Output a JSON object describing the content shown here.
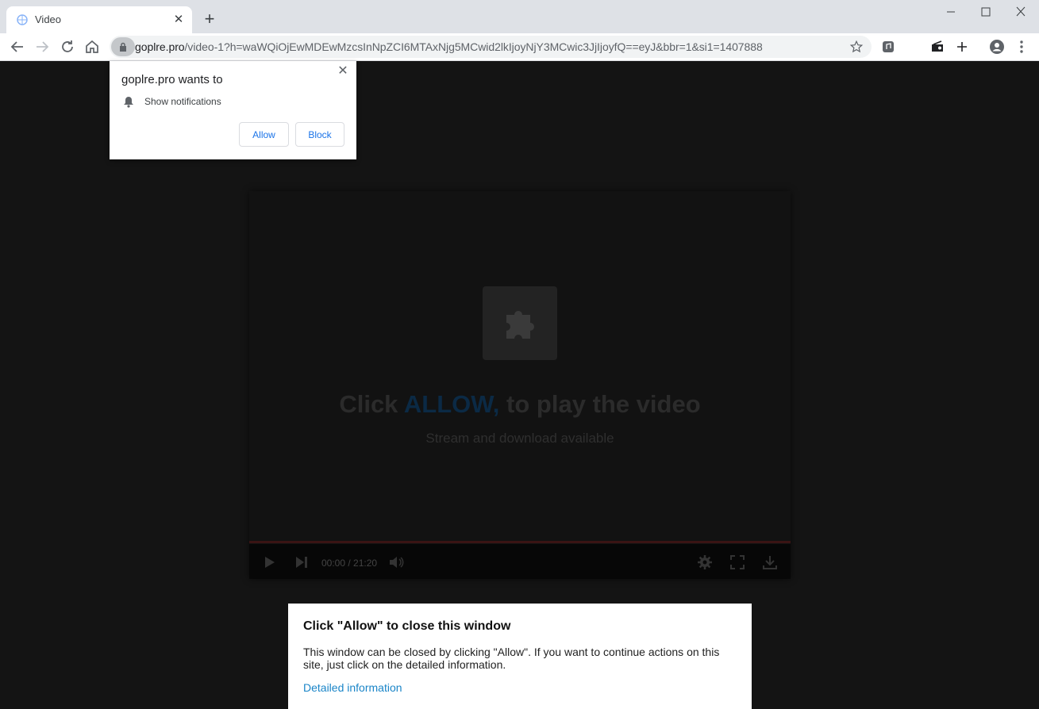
{
  "browser": {
    "tab_title": "Video",
    "url_host": "goplre.pro",
    "url_path": "/video-1?h=waWQiOjEwMDEwMzcsInNpZCI6MTAxNjg5MCwid2lkIjoyNjY3MCwic3JjIjoyfQ==eyJ&bbr=1&si1=1407888",
    "icons": [
      "tab-favicon",
      "close-icon",
      "plus-icon",
      "minimize-icon",
      "maximize-icon",
      "close-window-icon",
      "back-icon",
      "forward-icon",
      "reload-icon",
      "home-icon",
      "lock-icon",
      "star-icon",
      "media-icon",
      "cast-icon",
      "plus-icon",
      "profile-icon",
      "menu-icon"
    ]
  },
  "permission": {
    "title": "goplre.pro wants to",
    "item": "Show notifications",
    "allow_label": "Allow",
    "block_label": "Block"
  },
  "player": {
    "headline_pre": "Click ",
    "headline_highlight": "ALLOW,",
    "headline_post": " to play the video",
    "subline": "Stream and download available",
    "time": "00:00 / 21:20",
    "highlight_color": "#0b2a45"
  },
  "dialog": {
    "title": "Click \"Allow\" to close this window",
    "body": "This window can be closed by clicking \"Allow\". If you want to continue actions on this site, just click on the detailed information.",
    "link": "Detailed information"
  }
}
